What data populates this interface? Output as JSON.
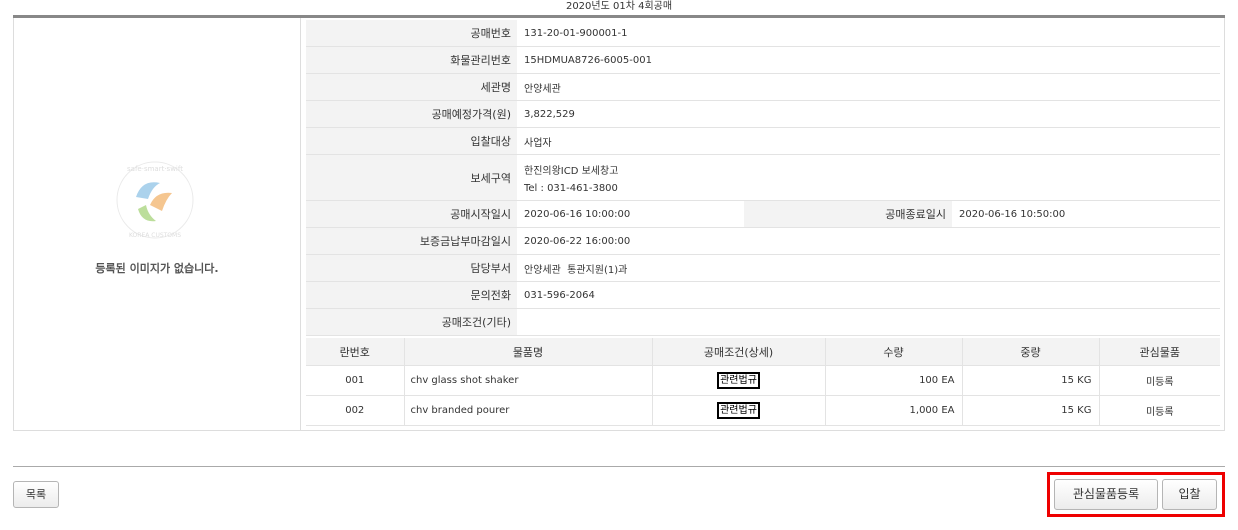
{
  "page": {
    "title": "2020년도 01차 4회공매"
  },
  "left_pane": {
    "no_image_text": "등록된 이미지가 없습니다.",
    "logo_icon": "korea-customs-service-logo"
  },
  "info": {
    "auction_no_label": "공매번호",
    "auction_no": "131-20-01-900001-1",
    "cargo_no_label": "화물관리번호",
    "cargo_no": "15HDMUA8726-6005-001",
    "customs_label": "세관명",
    "customs": "안양세관",
    "price_label": "공매예정가격(원)",
    "price": "3,822,529",
    "bidder_label": "입찰대상",
    "bidder": "사업자",
    "bonded_label": "보세구역",
    "bonded_name": "한진의왕ICD 보세창고",
    "bonded_tel": "Tel : 031-461-3800",
    "start_label": "공매시작일시",
    "start": "2020-06-16 10:00:00",
    "end_label": "공매종료일시",
    "end": "2020-06-16 10:50:00",
    "deposit_label": "보증금납부마감일시",
    "deposit": "2020-06-22 16:00:00",
    "dept_label": "담당부서",
    "dept": "안양세관  통관지원(1)과",
    "phone_label": "문의전화",
    "phone": "031-596-2064",
    "cond_label": "공매조건(기타)",
    "cond": ""
  },
  "items": {
    "headers": [
      "란번호",
      "물품명",
      "공매조건(상세)",
      "수량",
      "중량",
      "관심물품"
    ],
    "rows": [
      {
        "no": "001",
        "name": "chv glass shot shaker",
        "condition": "관련법규",
        "qty": "100 EA",
        "weight": "15 KG",
        "watch": "미등록"
      },
      {
        "no": "002",
        "name": "chv branded pourer",
        "condition": "관련법규",
        "qty": "1,000 EA",
        "weight": "15 KG",
        "watch": "미등록"
      }
    ]
  },
  "buttons": {
    "list": "목록",
    "watch_register": "관심물품등록",
    "bid": "입찰"
  },
  "colors": {
    "highlight": "#ee0000",
    "label_bg": "#f3f3f3",
    "rule": "#888888"
  }
}
